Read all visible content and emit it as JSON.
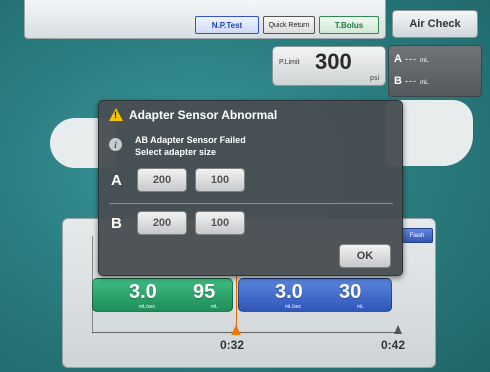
{
  "toolbar": {
    "np_test": "N.P.Test",
    "quick_return": "Quick Return",
    "t_bolus": "T.Bolus",
    "air_check": "Air Check"
  },
  "pressure_limit": {
    "label": "P.Limit",
    "value": "300",
    "unit": "psi"
  },
  "volumes": {
    "a_label": "A",
    "a_value": "---",
    "a_unit": "mL",
    "b_label": "B",
    "b_value": "---",
    "b_unit": "mL"
  },
  "protocol": {
    "flash_label": "Flash",
    "phase_a": {
      "rate": "3.0",
      "rate_unit": "mL/sec",
      "volume": "95",
      "volume_unit": "mL",
      "color": "#2aa36b"
    },
    "phase_b": {
      "rate": "3.0",
      "rate_unit": "mL/sec",
      "volume": "30",
      "volume_unit": "mL",
      "color": "#3f6ccc"
    },
    "marker_time": "0:32",
    "end_time": "0:42"
  },
  "dialog": {
    "title": "Adapter Sensor Abnormal",
    "message_line1": "AB Adapter Sensor Failed",
    "message_line2": "Select adapter size",
    "row_a": {
      "label": "A",
      "options": [
        "200",
        "100"
      ]
    },
    "row_b": {
      "label": "B",
      "options": [
        "200",
        "100"
      ]
    },
    "ok_label": "OK"
  },
  "icons": {
    "warning": "warning-triangle-icon",
    "info": "info-icon"
  }
}
